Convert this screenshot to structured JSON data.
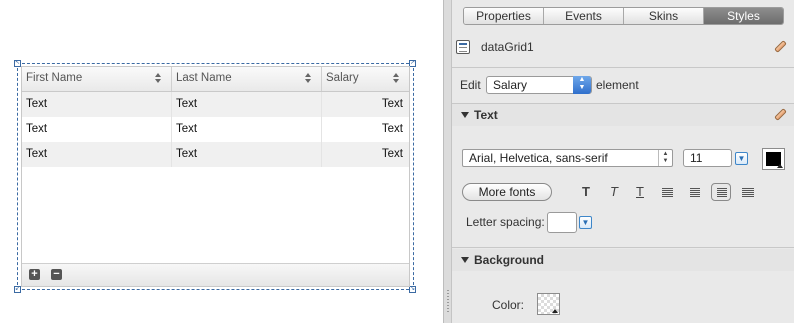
{
  "canvas": {
    "grid": {
      "columns": [
        "First Name",
        "Last Name",
        "Salary"
      ],
      "rows": [
        [
          "Text",
          "Text",
          "Text"
        ],
        [
          "Text",
          "Text",
          "Text"
        ],
        [
          "Text",
          "Text",
          "Text"
        ]
      ],
      "footer_buttons": [
        "+",
        "−"
      ]
    }
  },
  "inspector": {
    "tabs": [
      {
        "label": "Properties",
        "active": false
      },
      {
        "label": "Events",
        "active": false
      },
      {
        "label": "Skins",
        "active": false
      },
      {
        "label": "Styles",
        "active": true
      }
    ],
    "component_name": "dataGrid1",
    "edit": {
      "prefix": "Edit",
      "selected_element": "Salary",
      "suffix": "element"
    },
    "text_section": {
      "title": "Text",
      "font_family": "Arial, Helvetica, sans-serif",
      "font_size": "11",
      "text_color": "#000000",
      "more_fonts_label": "More fonts",
      "format_glyphs": {
        "bold": "T",
        "italic": "T",
        "underline": "T"
      },
      "active_alignment": "right",
      "letter_spacing_label": "Letter spacing:",
      "letter_spacing_value": ""
    },
    "background_section": {
      "title": "Background",
      "color_label": "Color:"
    }
  },
  "colors": {
    "selection": "#3b6aa3",
    "active_tab": "#7a7a7a",
    "panel_bg": "#e9e9e9"
  }
}
